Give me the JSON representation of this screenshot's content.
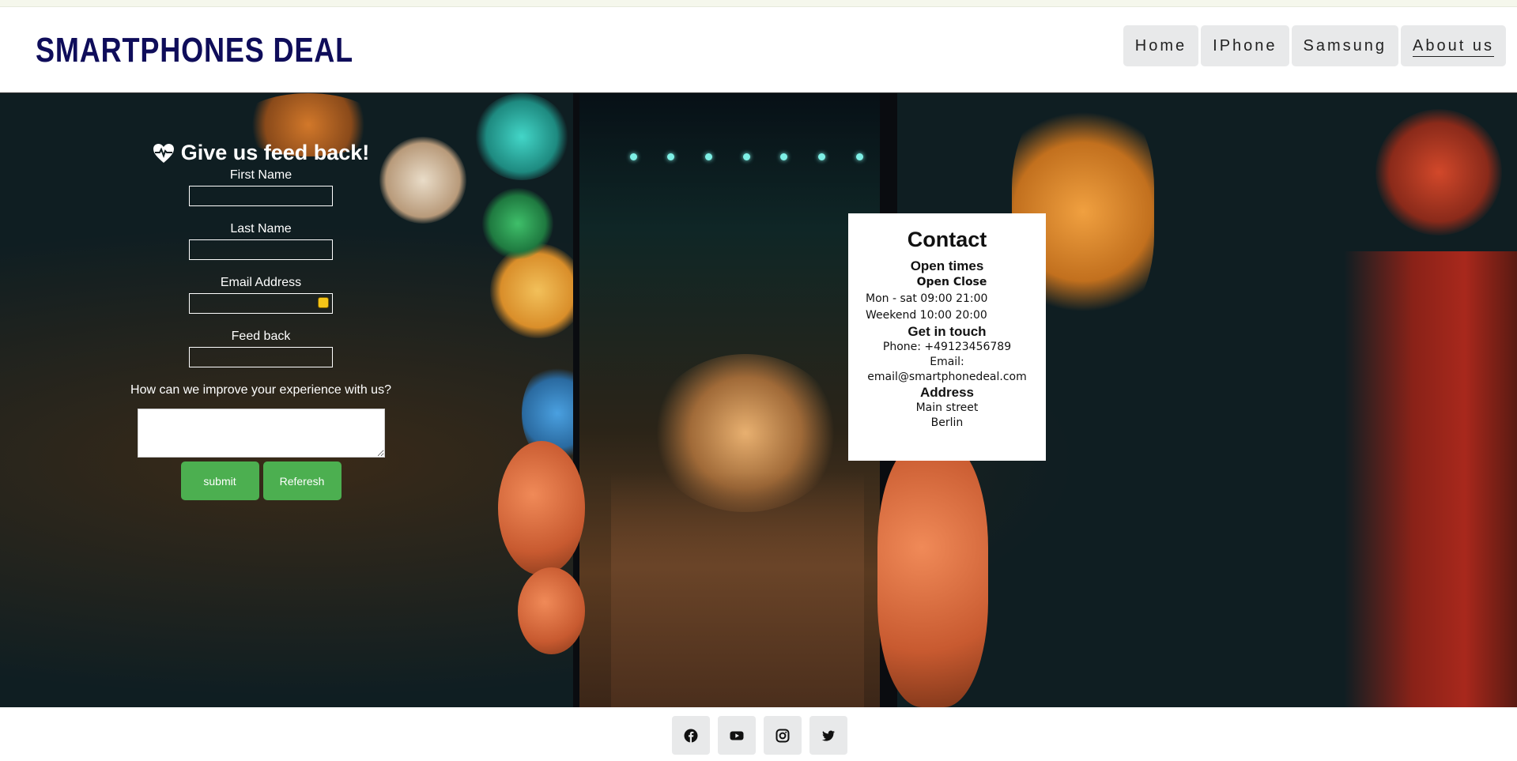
{
  "brand": {
    "logo_text": "SMARTPHONES DEAL"
  },
  "nav": {
    "items": [
      {
        "label": "Home",
        "active": false
      },
      {
        "label": "IPhone",
        "active": false
      },
      {
        "label": "Samsung",
        "active": false
      },
      {
        "label": "About us",
        "active": true
      }
    ]
  },
  "feedback": {
    "heading": "Give us feed back!",
    "heading_icon": "heartbeat-icon",
    "fields": {
      "first_name": {
        "label": "First Name",
        "value": ""
      },
      "last_name": {
        "label": "Last Name",
        "value": ""
      },
      "email": {
        "label": "Email Address",
        "value": ""
      },
      "feedback": {
        "label": "Feed back",
        "value": ""
      }
    },
    "question": "How can we improve your experience with us?",
    "textarea_value": "",
    "submit_label": "submit",
    "refresh_label": "Referesh"
  },
  "contact": {
    "title": "Contact",
    "open_times_heading": "Open times",
    "hours_header": "Open Close",
    "hours": [
      "Mon - sat 09:00 21:00",
      "Weekend 10:00 20:00"
    ],
    "get_in_touch_heading": "Get in touch",
    "phone": "Phone: +49123456789",
    "email_label": "Email:",
    "email": "email@smartphonedeal.com",
    "address_heading": "Address",
    "street": "Main street",
    "city": "Berlin"
  },
  "footer": {
    "social": [
      "facebook-icon",
      "youtube-icon",
      "instagram-icon",
      "twitter-icon"
    ]
  },
  "colors": {
    "logo": "#0f0d5a",
    "button_green": "#4caf50",
    "nav_bg": "#e8e9ea"
  }
}
